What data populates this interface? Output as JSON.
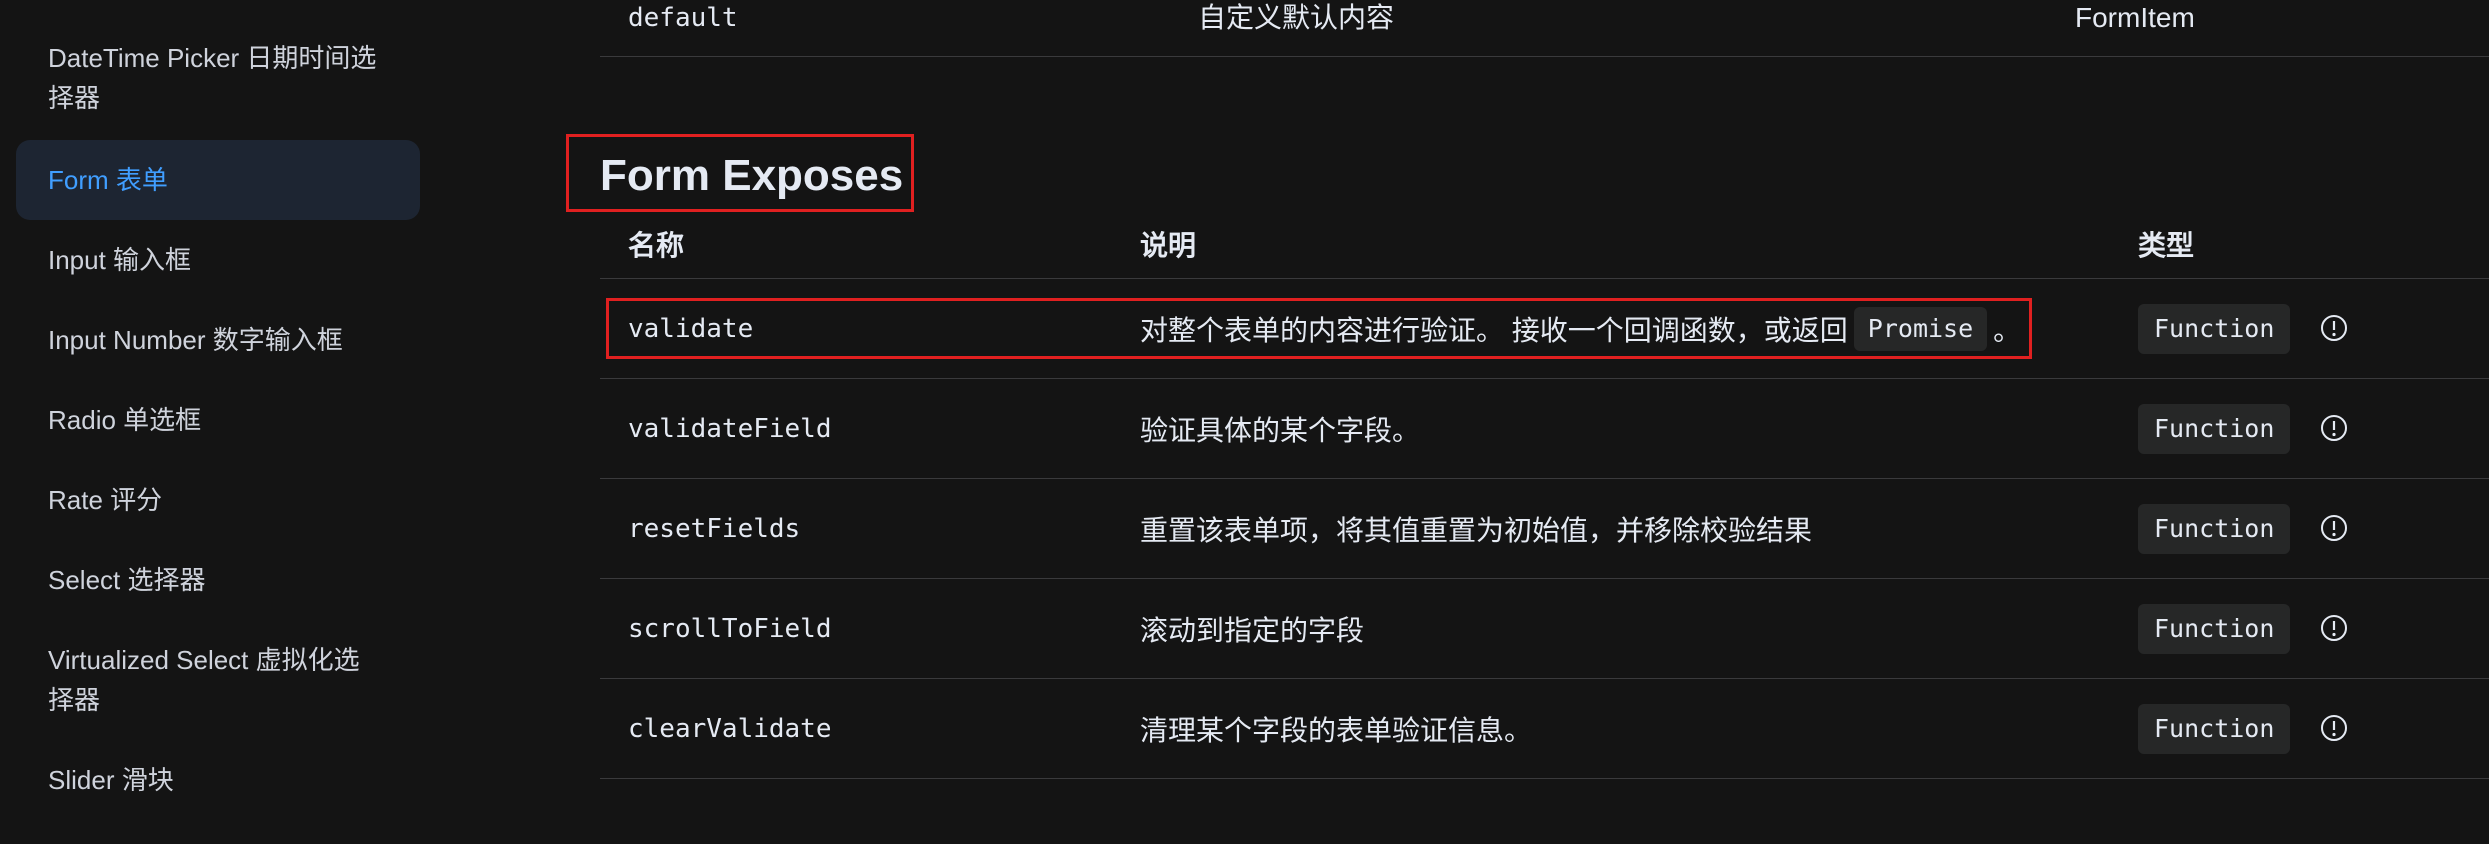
{
  "sidebar": {
    "items": [
      {
        "label": "DateTime Picker 日期时间选",
        "label2": "择器"
      },
      {
        "label": "Form 表单"
      },
      {
        "label": "Input 输入框"
      },
      {
        "label": "Input Number 数字输入框"
      },
      {
        "label": "Radio 单选框"
      },
      {
        "label": "Rate 评分"
      },
      {
        "label": "Select 选择器"
      },
      {
        "label": "Virtualized Select 虚拟化选",
        "label2": "择器"
      },
      {
        "label": "Slider 滑块"
      }
    ]
  },
  "slots_table": {
    "last_row": {
      "name": "default",
      "desc": "自定义默认内容",
      "type": "FormItem"
    }
  },
  "exposes": {
    "title": "Form Exposes",
    "headers": {
      "name": "名称",
      "desc": "说明",
      "type": "类型"
    },
    "rows": [
      {
        "name": "validate",
        "desc_before": "对整个表单的内容进行验证。 接收一个回调函数，或返回",
        "code": "Promise",
        "desc_after": "。",
        "type": "Function",
        "info_icon": "info-circle-icon"
      },
      {
        "name": "validateField",
        "desc": "验证具体的某个字段。",
        "type": "Function",
        "info_icon": "info-circle-icon"
      },
      {
        "name": "resetFields",
        "desc": "重置该表单项，将其值重置为初始值，并移除校验结果",
        "type": "Function",
        "info_icon": "info-circle-icon"
      },
      {
        "name": "scrollToField",
        "desc": "滚动到指定的字段",
        "type": "Function",
        "info_icon": "info-circle-icon"
      },
      {
        "name": "clearValidate",
        "desc": "清理某个字段的表单验证信息。",
        "type": "Function",
        "info_icon": "info-circle-icon"
      }
    ]
  },
  "colors": {
    "background": "#141414",
    "active_item_bg": "#1d2532",
    "active_item_text": "#409eff",
    "highlight_box": "#e02020"
  }
}
